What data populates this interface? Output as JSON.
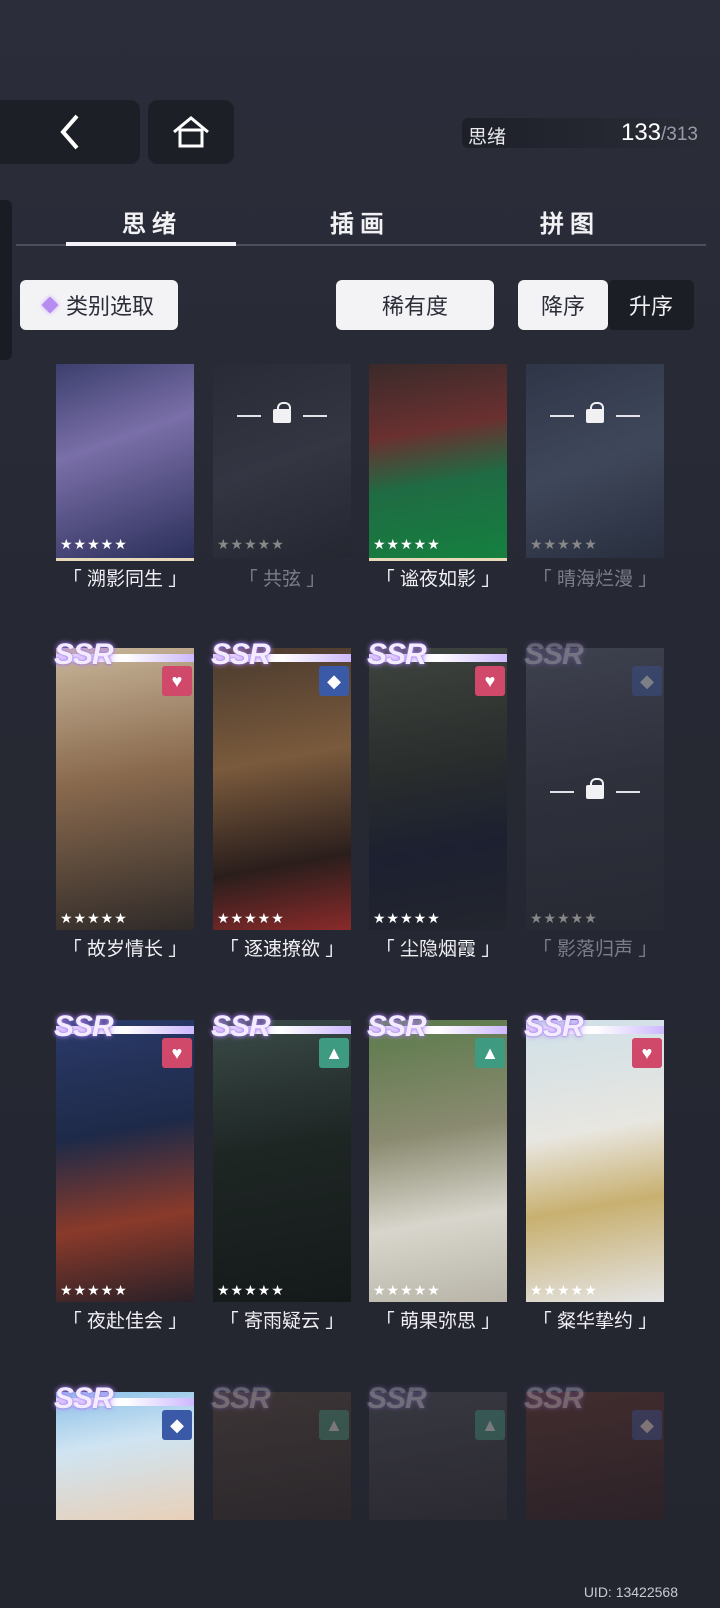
{
  "counter": {
    "label": "思绪",
    "current": "133",
    "total": "/313"
  },
  "tabs": [
    "思绪",
    "插画",
    "拼图"
  ],
  "filters": {
    "category": "类别选取",
    "rarity": "稀有度",
    "desc": "降序",
    "asc": "升序"
  },
  "row1": [
    {
      "name": "「 溯影同生 」",
      "stars": "★★★★★",
      "locked": false
    },
    {
      "name": "「 共弦 」",
      "stars": "★★★★★",
      "locked": true
    },
    {
      "name": "「 谧夜如影 」",
      "stars": "★★★★★",
      "locked": false
    },
    {
      "name": "「 晴海烂漫 」",
      "stars": "★★★★★",
      "locked": true
    }
  ],
  "row2": [
    {
      "name": "「 故岁情长 」",
      "stars": "★★★★★",
      "ssr": "SSR",
      "badge": "heart-icon",
      "locked": false
    },
    {
      "name": "「 逐速撩欲 」",
      "stars": "★★★★★",
      "ssr": "SSR",
      "badge": "flash-diamond-icon",
      "locked": false
    },
    {
      "name": "「 尘隐烟霞 」",
      "stars": "★★★★★",
      "ssr": "SSR",
      "badge": "heart-icon",
      "locked": false
    },
    {
      "name": "「 影落归声 」",
      "stars": "★★★★★",
      "ssr": "SSR",
      "badge": "flash-diamond-icon",
      "locked": true
    }
  ],
  "row3": [
    {
      "name": "「 夜赴佳会 」",
      "stars": "★★★★★",
      "ssr": "SSR",
      "badge": "heart-icon",
      "locked": false
    },
    {
      "name": "「 寄雨疑云 」",
      "stars": "★★★★★",
      "ssr": "SSR",
      "badge": "triangle-icon",
      "locked": false
    },
    {
      "name": "「 萌果弥思 」",
      "stars": "★★★★★",
      "ssr": "SSR",
      "badge": "triangle-icon",
      "locked": false
    },
    {
      "name": "「 粲华挚约 」",
      "stars": "★★★★★",
      "ssr": "SSR",
      "badge": "heart-icon",
      "locked": false
    }
  ],
  "row4": [
    {
      "ssr": "SSR",
      "badge": "flash-diamond-icon",
      "locked": false
    },
    {
      "ssr": "SSR",
      "badge": "triangle-icon",
      "locked": true
    },
    {
      "ssr": "SSR",
      "badge": "triangle-icon",
      "locked": true
    },
    {
      "ssr": "SSR",
      "badge": "flash-diamond-icon",
      "locked": true
    }
  ],
  "uid": "UID: 13422568",
  "colors": {
    "heart": "#d0486a",
    "flash": "#3a5aa8",
    "triangle": "#3e9a80",
    "accent": "#b68cf0"
  }
}
